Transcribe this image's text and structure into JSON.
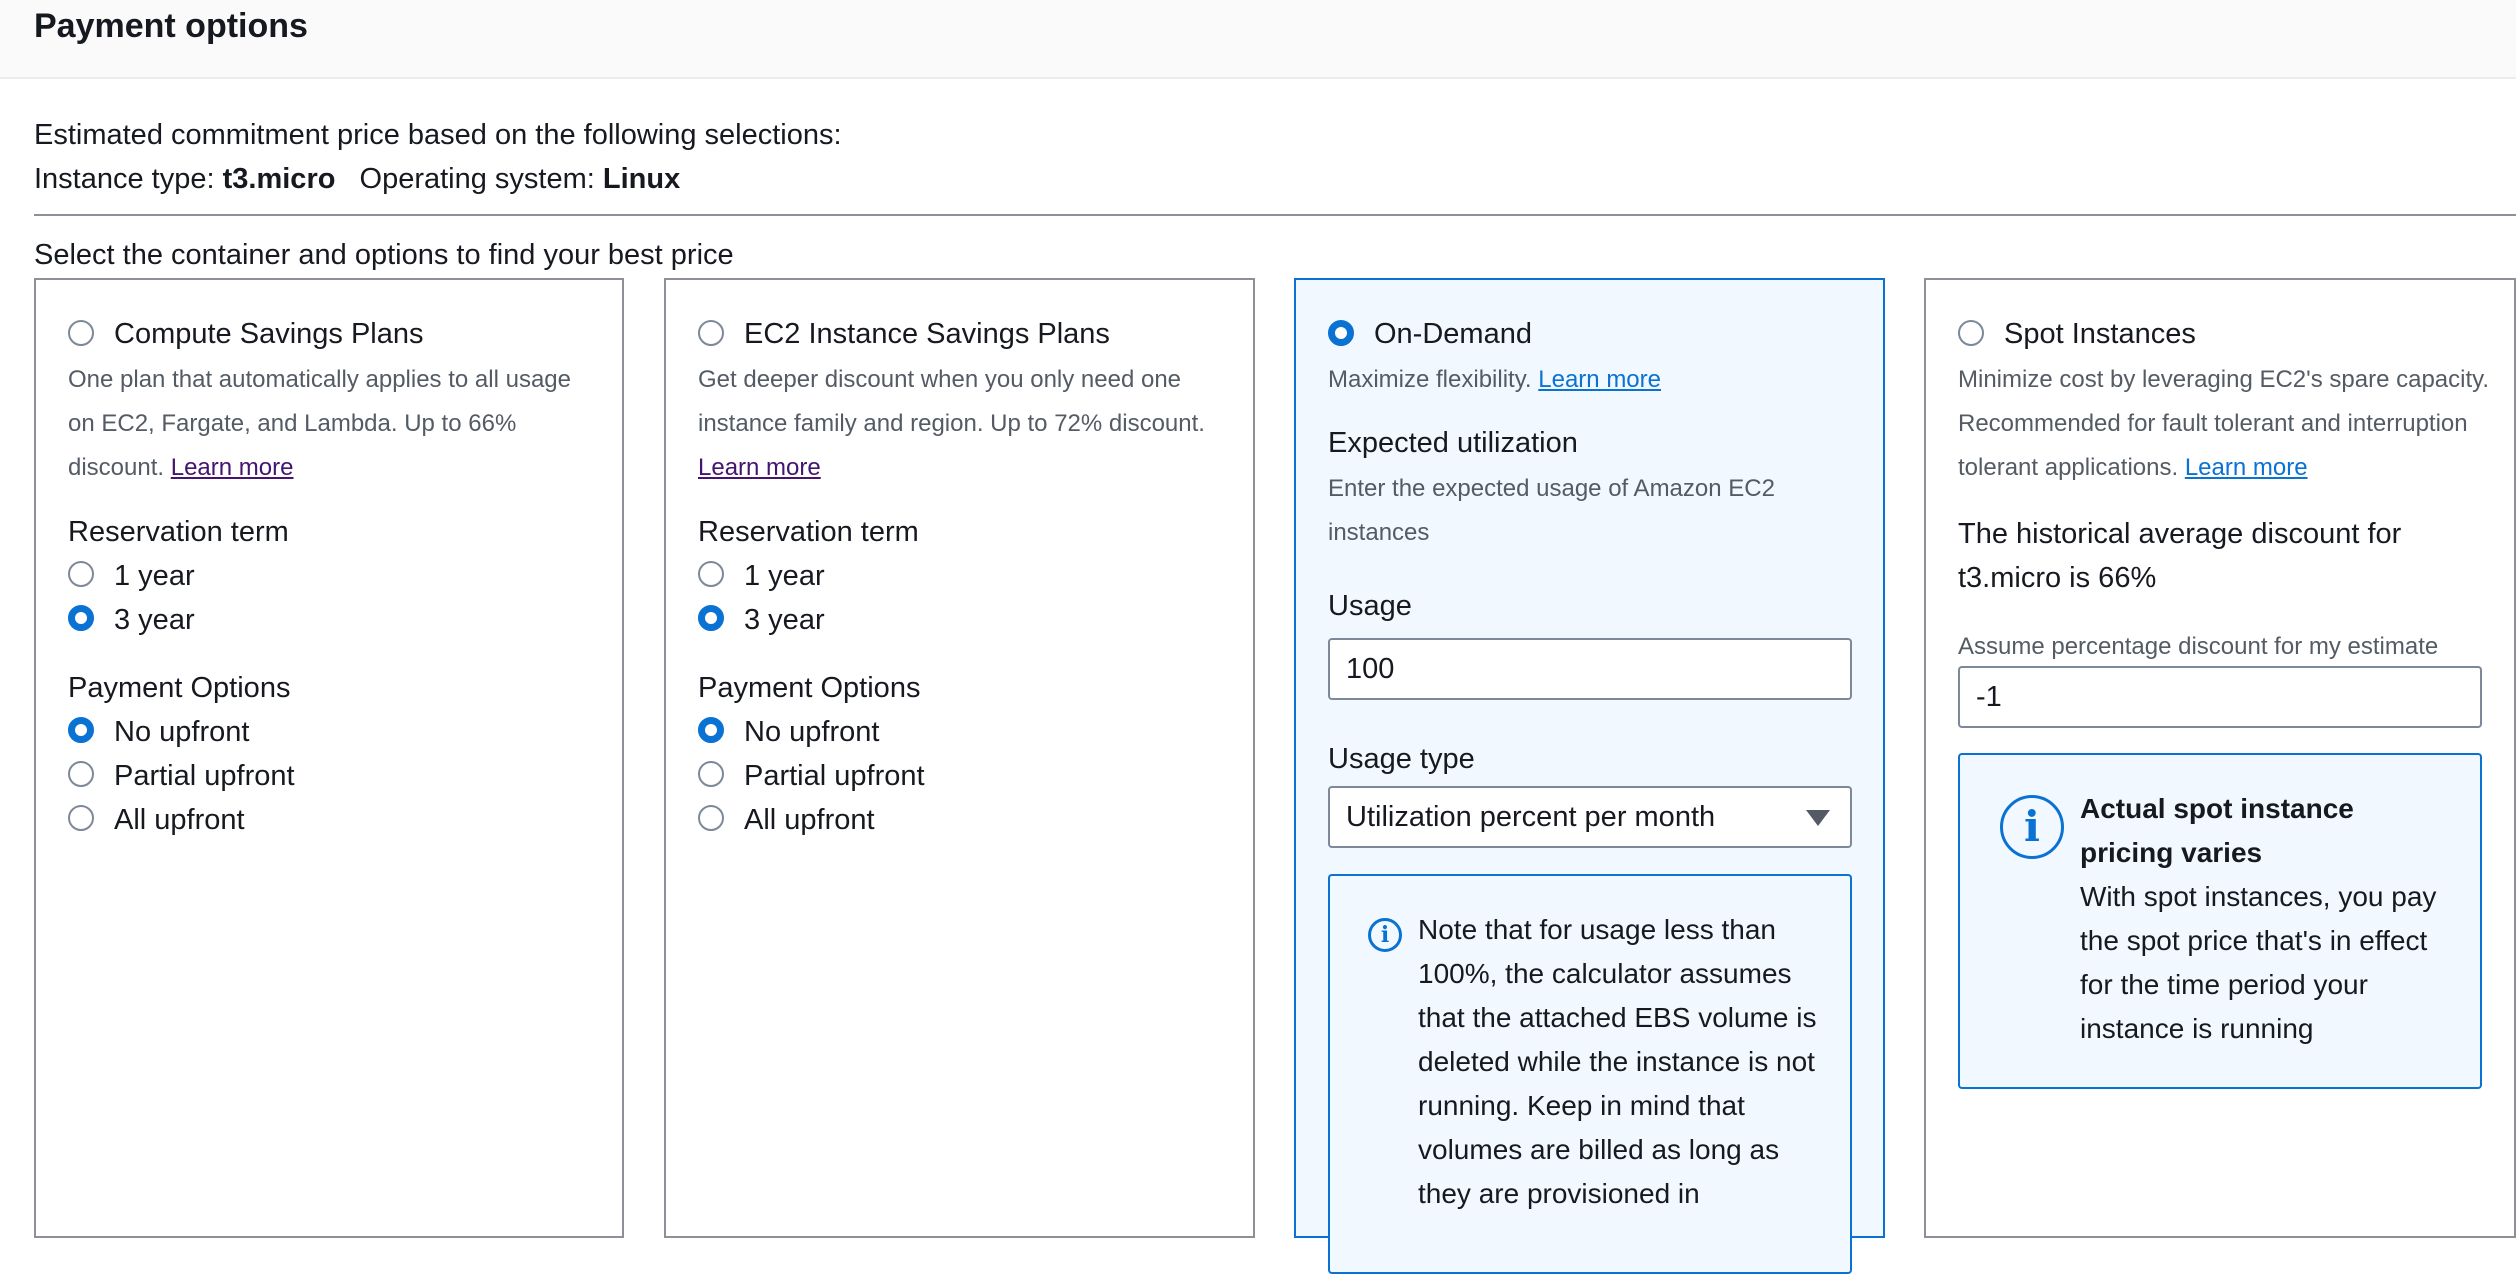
{
  "header": {
    "title": "Payment options"
  },
  "selections": {
    "intro": "Estimated commitment price based on the following selections:",
    "instance_type_label": "Instance type:",
    "instance_type_value": "t3.micro",
    "os_label": "Operating system:",
    "os_value": "Linux"
  },
  "container_prompt": "Select the container and options to find your best price",
  "cards": {
    "compute": {
      "title": "Compute Savings Plans",
      "description": "One plan that automatically applies to all usage on EC2, Fargate, and Lambda. Up to 66% discount.",
      "learn_more": "Learn more",
      "reservation_term_label": "Reservation term",
      "term_options": [
        "1 year",
        "3 year"
      ],
      "payment_label": "Payment Options",
      "payment_options": [
        "No upfront",
        "Partial upfront",
        "All upfront"
      ]
    },
    "ec2": {
      "title": "EC2 Instance Savings Plans",
      "description": "Get deeper discount when you only need one instance family and region. Up to 72% discount.",
      "learn_more": "Learn more",
      "reservation_term_label": "Reservation term",
      "term_options": [
        "1 year",
        "3 year"
      ],
      "payment_label": "Payment Options",
      "payment_options": [
        "No upfront",
        "Partial upfront",
        "All upfront"
      ]
    },
    "ondemand": {
      "title": "On-Demand",
      "description": "Maximize flexibility.",
      "learn_more": "Learn more",
      "utilization_label": "Expected utilization",
      "utilization_desc": "Enter the expected usage of Amazon EC2 instances",
      "usage_label": "Usage",
      "usage_value": "100",
      "usage_type_label": "Usage type",
      "usage_type_value": "Utilization percent per month",
      "note": "Note that for usage less than 100%, the calculator assumes that the attached EBS volume is deleted while the instance is not running. Keep in mind that volumes are billed as long as they are provisioned in"
    },
    "spot": {
      "title": "Spot Instances",
      "description": "Minimize cost by leveraging EC2's spare capacity. Recommended for fault tolerant and interruption tolerant applications.",
      "learn_more": "Learn more",
      "historical": "The historical average discount for t3.micro is 66%",
      "discount_label": "Assume percentage discount for my estimate",
      "discount_value": "-1",
      "alert_title": "Actual spot instance pricing varies",
      "alert_body": "With spot instances, you pay the spot price that's in effect for the time period your instance is running"
    }
  },
  "colors": {
    "accent": "#0972d3",
    "selected_bg": "#f1f8ff",
    "visited_link": "#44146e"
  },
  "icons": {
    "info": "info-circle-icon",
    "caret": "caret-down-icon"
  }
}
